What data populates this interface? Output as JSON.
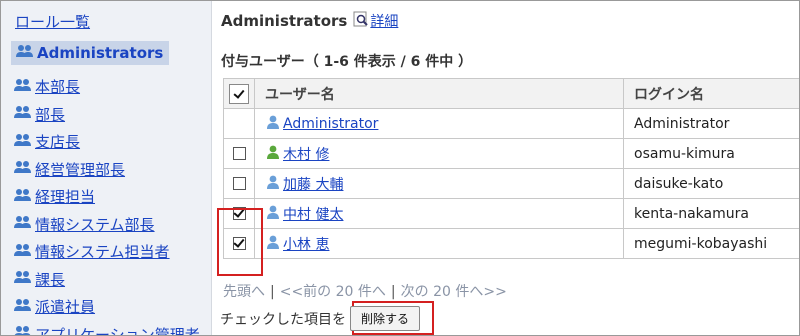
{
  "sidebar": {
    "header": "ロール一覧",
    "selected": "Administrators",
    "items": [
      {
        "label": "本部長"
      },
      {
        "label": "部長"
      },
      {
        "label": "支店長"
      },
      {
        "label": "経営管理部長"
      },
      {
        "label": "経理担当"
      },
      {
        "label": "情報システム部長"
      },
      {
        "label": "情報システム担当者"
      },
      {
        "label": "課長"
      },
      {
        "label": "派遣社員"
      },
      {
        "label": "アプリケーション管理者"
      }
    ]
  },
  "main": {
    "title": "Administrators",
    "detail_link": "詳細",
    "subtitle": "付与ユーザー（ 1-6 件表示 / 6 件中 ）",
    "table": {
      "headers": {
        "user": "ユーザー名",
        "login": "ログイン名"
      },
      "rows": [
        {
          "name": "Administrator",
          "login": "Administrator",
          "checkbox": false,
          "icon_color": "#6a9fd8"
        },
        {
          "name": "木村 修",
          "login": "osamu-kimura",
          "checkbox": true,
          "checked": false,
          "icon_color": "#5aa83c"
        },
        {
          "name": "加藤 大輔",
          "login": "daisuke-kato",
          "checkbox": true,
          "checked": false,
          "icon_color": "#6a9fd8"
        },
        {
          "name": "中村 健太",
          "login": "kenta-nakamura",
          "checkbox": true,
          "checked": true,
          "icon_color": "#6a9fd8"
        },
        {
          "name": "小林 恵",
          "login": "megumi-kobayashi",
          "checkbox": true,
          "checked": true,
          "icon_color": "#6a9fd8"
        }
      ]
    },
    "pager": {
      "first": "先頭へ",
      "prev": "<<前の 20 件へ",
      "next": "次の 20 件へ>>"
    },
    "bottom": {
      "label": "チェックした項目を",
      "delete_button": "削除する"
    }
  },
  "colors": {
    "link": "#1a44c2",
    "highlight": "#d42020",
    "sidebar_bg": "#eef1f6"
  }
}
